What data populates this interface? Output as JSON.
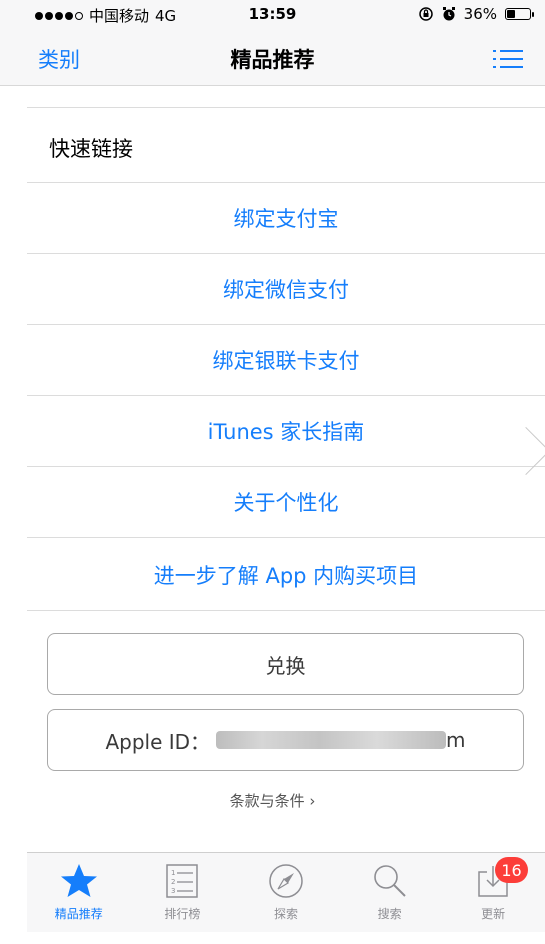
{
  "status_bar": {
    "carrier": "中国移动",
    "network": "4G",
    "time": "13:59",
    "battery_percent": "36%",
    "battery_level": 0.36,
    "icons": [
      "orientation-lock-icon",
      "alarm-icon",
      "battery-icon"
    ]
  },
  "nav": {
    "back_label": "类别",
    "title": "精品推荐",
    "menu_icon": "list-menu-icon"
  },
  "quick_links": {
    "header": "快速链接",
    "items": [
      "绑定支付宝",
      "绑定微信支付",
      "绑定银联卡支付",
      "iTunes 家长指南",
      "关于个性化",
      "进一步了解 App 内购买项目"
    ]
  },
  "actions": {
    "redeem_label": "兑换",
    "apple_id_prefix": "Apple ID：",
    "apple_id_suffix": "m"
  },
  "terms_label": "条款与条件 ›",
  "tab_bar": {
    "tabs": [
      {
        "label": "精品推荐",
        "icon": "star-icon",
        "active": true
      },
      {
        "label": "排行榜",
        "icon": "ranking-list-icon",
        "active": false
      },
      {
        "label": "探索",
        "icon": "compass-icon",
        "active": false
      },
      {
        "label": "搜索",
        "icon": "search-icon",
        "active": false
      },
      {
        "label": "更新",
        "icon": "download-icon",
        "active": false,
        "badge": "16"
      }
    ]
  },
  "colors": {
    "accent": "#157efb",
    "badge": "#fc3d39",
    "inactive": "#8e8e93"
  }
}
